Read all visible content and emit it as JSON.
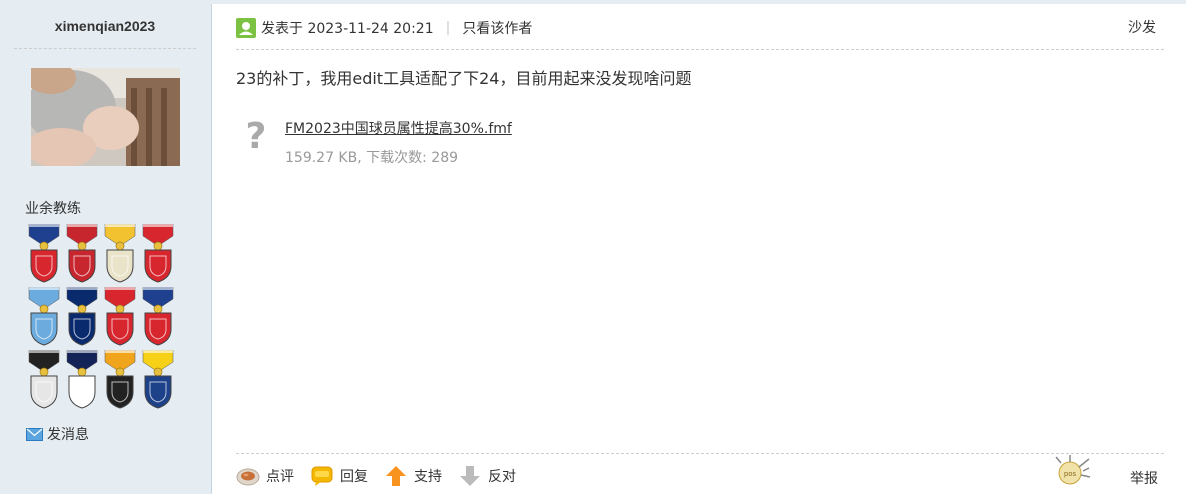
{
  "sidebar": {
    "username": "ximenqian2023",
    "rank": "业余教练",
    "send_message": "发消息",
    "medals": [
      {
        "icon": "croatia-crest-icon",
        "ribbon": "#1f3f8f",
        "shield": "#d8262e"
      },
      {
        "icon": "liverpool-crest-icon",
        "ribbon": "#c8262e",
        "shield": "#c8262e"
      },
      {
        "icon": "real-madrid-crest-icon",
        "ribbon": "#f2c230",
        "shield": "#e9e3c9"
      },
      {
        "icon": "manchester-united-crest-icon",
        "ribbon": "#d8262e",
        "shield": "#d8262e"
      },
      {
        "icon": "manchester-city-crest-icon",
        "ribbon": "#6cabdd",
        "shield": "#6cabdd"
      },
      {
        "icon": "inter-milan-crest-icon",
        "ribbon": "#0a2a6e",
        "shield": "#0a2a6e"
      },
      {
        "icon": "nottingham-forest-crest-icon",
        "ribbon": "#d8262e",
        "shield": "#d8262e"
      },
      {
        "icon": "atletico-madrid-crest-icon",
        "ribbon": "#1f3f8f",
        "shield": "#d8262e"
      },
      {
        "icon": "newcastle-crest-icon",
        "ribbon": "#222222",
        "shield": "#e6e6e6"
      },
      {
        "icon": "tottenham-crest-icon",
        "ribbon": "#132257",
        "shield": "#ffffff"
      },
      {
        "icon": "wolves-crest-icon",
        "ribbon": "#f1a51c",
        "shield": "#222222"
      },
      {
        "icon": "leeds-crest-icon",
        "ribbon": "#f7d117",
        "shield": "#1d428a"
      }
    ]
  },
  "post": {
    "posted_prefix": "发表于 2023-11-24 20:21",
    "only_author": "只看该作者",
    "floor": "沙发",
    "content": "23的补丁，我用edit工具适配了下24，目前用起来没发现啥问题",
    "attachment": {
      "icon": "unknown-file-icon",
      "name": "FM2023中国球员属性提高30%.fmf",
      "meta": "159.27 KB, 下载次数: 289"
    }
  },
  "actions": {
    "comment": "点评",
    "reply": "回复",
    "support": "支持",
    "oppose": "反对",
    "report": "举报"
  },
  "colors": {
    "sidebar_bg": "#e5edf2",
    "support_arrow": "#f7931e",
    "oppose_arrow": "#bbbbbb",
    "online_green": "#7cc242"
  }
}
